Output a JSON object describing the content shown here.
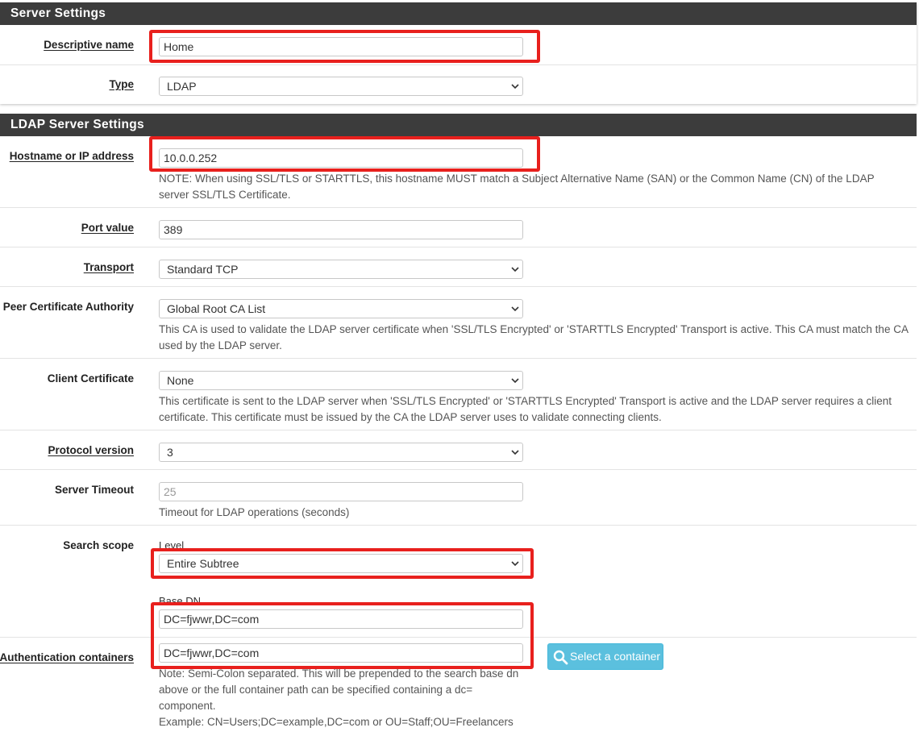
{
  "server_settings": {
    "heading": "Server Settings",
    "descriptive_name": {
      "label": "Descriptive name",
      "value": "Home"
    },
    "type": {
      "label": "Type",
      "value": "LDAP"
    }
  },
  "ldap_settings": {
    "heading": "LDAP Server Settings",
    "hostname": {
      "label": "Hostname or IP address",
      "value": "10.0.0.252",
      "help": "NOTE: When using SSL/TLS or STARTTLS, this hostname MUST match a Subject Alternative Name (SAN) or the Common Name (CN) of the LDAP server SSL/TLS Certificate."
    },
    "port": {
      "label": "Port value",
      "value": "389"
    },
    "transport": {
      "label": "Transport",
      "value": "Standard TCP"
    },
    "peer_ca": {
      "label": "Peer Certificate Authority",
      "value": "Global Root CA List",
      "help": "This CA is used to validate the LDAP server certificate when 'SSL/TLS Encrypted' or 'STARTTLS Encrypted' Transport is active. This CA must match the CA used by the LDAP server."
    },
    "client_cert": {
      "label": "Client Certificate",
      "value": "None",
      "help": "This certificate is sent to the LDAP server when 'SSL/TLS Encrypted' or 'STARTTLS Encrypted' Transport is active and the LDAP server requires a client certificate. This certificate must be issued by the CA the LDAP server uses to validate connecting clients."
    },
    "protocol": {
      "label": "Protocol version",
      "value": "3"
    },
    "timeout": {
      "label": "Server Timeout",
      "placeholder": "25",
      "help": "Timeout for LDAP operations (seconds)"
    },
    "search_scope": {
      "label": "Search scope",
      "level_label": "Level",
      "level_value": "Entire Subtree",
      "base_dn_label": "Base DN",
      "base_dn_value": "DC=fjwwr,DC=com"
    },
    "auth_containers": {
      "label": "Authentication containers",
      "value": "DC=fjwwr,DC=com",
      "button": "Select a container",
      "help": "Note: Semi-Colon separated. This will be prepended to the search base dn above or the full container path can be specified containing a dc= component.",
      "example": "Example: CN=Users;DC=example,DC=com or OU=Staff;OU=Freelancers"
    }
  },
  "colors": {
    "heading_bg": "#3c3c3c",
    "highlight": "#e8201d",
    "info_button": "#5bc0de"
  }
}
